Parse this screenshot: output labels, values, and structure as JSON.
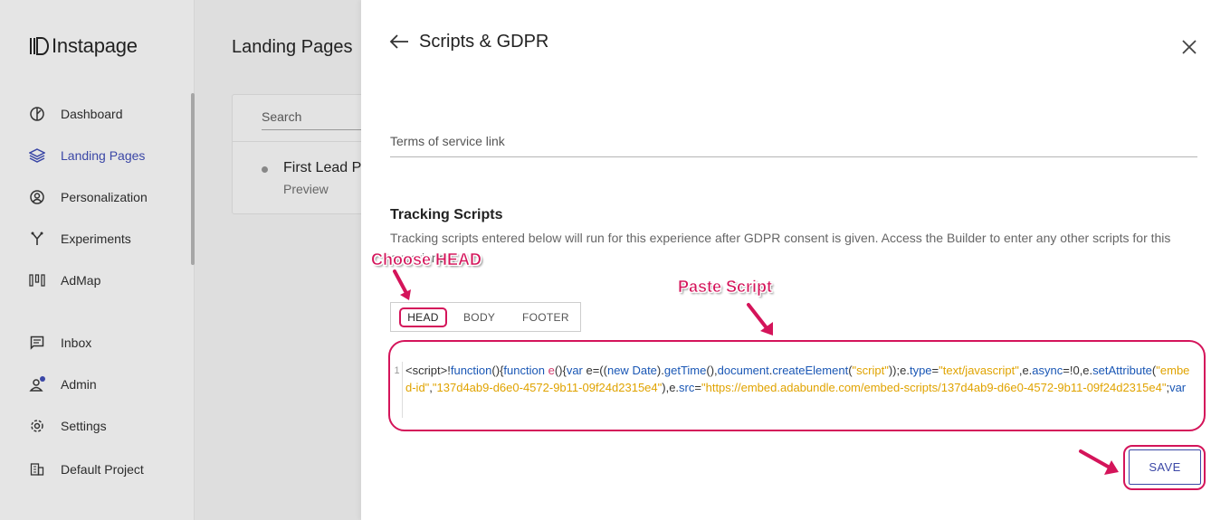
{
  "app": {
    "name": "Instapage"
  },
  "sidebar": {
    "items": [
      {
        "label": "Dashboard",
        "icon": "dashboard-icon"
      },
      {
        "label": "Landing Pages",
        "icon": "layers-icon",
        "active": true
      },
      {
        "label": "Personalization",
        "icon": "user-circle-icon"
      },
      {
        "label": "Experiments",
        "icon": "fork-icon"
      },
      {
        "label": "AdMap",
        "icon": "bars-icon"
      },
      {
        "label": "Inbox",
        "icon": "message-icon"
      },
      {
        "label": "Admin",
        "icon": "person-icon"
      },
      {
        "label": "Settings",
        "icon": "gear-icon"
      },
      {
        "label": "Default Project",
        "icon": "building-icon"
      }
    ]
  },
  "main": {
    "title": "Landing Pages",
    "search_label": "Search",
    "lead": {
      "title": "First Lead P",
      "subtitle": "Preview"
    }
  },
  "panel": {
    "title": "Scripts & GDPR",
    "tos_label": "Terms of service link",
    "tracking": {
      "title": "Tracking Scripts",
      "description": "Tracking scripts entered below will run for this experience after GDPR consent is given. Access the Builder to enter any other scripts for this experience."
    },
    "tabs": [
      "HEAD",
      "BODY",
      "FOOTER"
    ],
    "editor": {
      "line_number": "1",
      "code": "<script>!function(){function e(){var e=((new Date).getTime(),document.createElement(\"script\"));e.type=\"text/javascript\",e.async=!0,e.setAttribute(\"embed-id\",\"137d4ab9-d6e0-4572-9b11-09f24d2315e4\"),e.src=\"https://embed.adabundle.com/embed-scripts/137d4ab9-d6e0-4572-9b11-09f24d2315e4\";var"
    },
    "save_label": "SAVE"
  },
  "annotations": {
    "choose_head": "Choose HEAD",
    "paste_script": "Paste Script",
    "color": "#d4145a"
  },
  "colors": {
    "accent": "#3b47a6",
    "annotation": "#d4145a"
  }
}
